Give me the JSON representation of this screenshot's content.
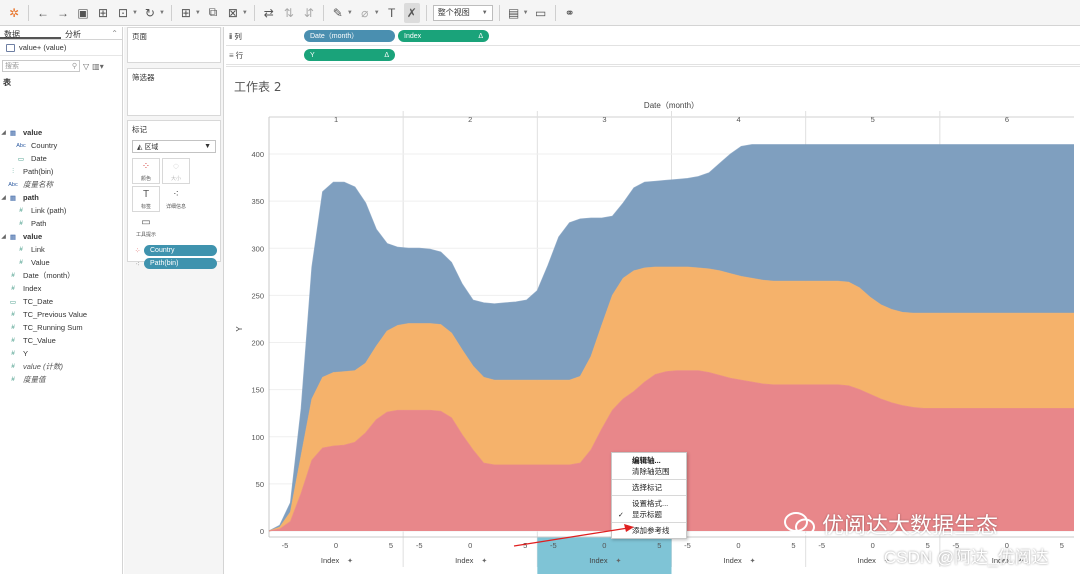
{
  "toolbar": {
    "fit_select": "整个视图"
  },
  "data_pane": {
    "tabs": [
      "数据",
      "分析"
    ],
    "datasource": "value+ (value)",
    "search_placeholder": "搜索",
    "section_title": "表",
    "fields": [
      {
        "label": "value",
        "kind": "table",
        "level": 0,
        "style": "bold",
        "caret": true
      },
      {
        "label": "Country",
        "kind": "abc",
        "level": 1
      },
      {
        "label": "Date",
        "kind": "date",
        "level": 1
      },
      {
        "label": "Path(bin)",
        "kind": "bin",
        "level": 0
      },
      {
        "label": "度量名称",
        "kind": "abc",
        "level": 0,
        "style": "italic"
      },
      {
        "label": "path",
        "kind": "table",
        "level": 0,
        "style": "bold",
        "caret": true
      },
      {
        "label": "Link (path)",
        "kind": "num",
        "level": 1
      },
      {
        "label": "Path",
        "kind": "num",
        "level": 1
      },
      {
        "label": "value",
        "kind": "table",
        "level": 0,
        "style": "bold",
        "caret": true
      },
      {
        "label": "Link",
        "kind": "num",
        "level": 1
      },
      {
        "label": "Value",
        "kind": "num",
        "level": 1
      },
      {
        "label": "Date（month）",
        "kind": "num",
        "level": 0
      },
      {
        "label": "Index",
        "kind": "num",
        "level": 0
      },
      {
        "label": "TC_Date",
        "kind": "date",
        "level": 0
      },
      {
        "label": "TC_Previous Value",
        "kind": "num",
        "level": 0
      },
      {
        "label": "TC_Running Sum",
        "kind": "num",
        "level": 0
      },
      {
        "label": "TC_Value",
        "kind": "num",
        "level": 0
      },
      {
        "label": "Y",
        "kind": "num",
        "level": 0
      },
      {
        "label": "value (计数)",
        "kind": "num",
        "level": 0,
        "style": "italic"
      },
      {
        "label": "度量值",
        "kind": "num",
        "level": 0,
        "style": "italic"
      }
    ]
  },
  "cards": {
    "pages": "页面",
    "filters": "筛选器",
    "marks": "标记",
    "mark_type": "区域",
    "mark_buttons": [
      "颜色",
      "大小",
      "标签",
      "详细信息",
      "工具提示"
    ],
    "mark_pills": [
      "Country",
      "Path(bin)"
    ]
  },
  "shelves": {
    "columns_label": "列",
    "rows_label": "行",
    "column_pills": [
      "Date（month）",
      "Index"
    ],
    "row_pills": [
      "Y"
    ],
    "delta": "Δ"
  },
  "sheet": {
    "title": "工作表 2"
  },
  "chart_data": {
    "type": "area",
    "top_title": "Date（month）",
    "panels": [
      "1",
      "2",
      "3",
      "4",
      "5",
      "6"
    ],
    "ylabel": "Y",
    "ylim": [
      0,
      420
    ],
    "yticks": [
      0,
      50,
      100,
      150,
      200,
      250,
      300,
      350,
      400
    ],
    "xlabel": "Index",
    "xticks": [
      "-5",
      "0",
      "5"
    ],
    "x": [
      -5,
      -4,
      -3,
      -2,
      -1,
      0,
      1,
      2,
      3,
      4,
      5,
      6,
      7,
      8,
      9,
      10,
      11,
      12,
      13,
      14,
      15,
      16,
      17,
      18,
      19,
      20,
      21,
      22,
      23,
      24,
      25,
      26,
      27,
      28,
      29,
      30,
      31,
      32,
      33,
      34,
      35,
      36,
      37,
      38,
      39,
      40,
      41,
      42,
      43,
      44,
      45,
      46,
      47,
      48,
      49,
      50,
      51,
      52,
      53,
      54,
      55,
      56,
      57,
      58,
      59,
      60,
      61,
      62,
      63,
      64,
      65,
      66,
      67,
      68,
      69,
      70
    ],
    "colors": [
      "#e8878a",
      "#f5b26b",
      "#7f9fbf"
    ],
    "layer_boundaries": [
      [
        0,
        2,
        10,
        40,
        75,
        88,
        90,
        91,
        94,
        104,
        118,
        126,
        128,
        128,
        128,
        128,
        127,
        120,
        102,
        86,
        72,
        70,
        70,
        70,
        70,
        70,
        70,
        70,
        70,
        72,
        86,
        108,
        128,
        140,
        148,
        158,
        166,
        169,
        170,
        170,
        170,
        168,
        165,
        162,
        160,
        158,
        156,
        155,
        155,
        155,
        155,
        155,
        155,
        155,
        154,
        150,
        145,
        140,
        136,
        133,
        131,
        130,
        130,
        130,
        130,
        130,
        130,
        130,
        130,
        130,
        130,
        130,
        130,
        130,
        130,
        130
      ],
      [
        0,
        4,
        20,
        80,
        140,
        163,
        168,
        169,
        170,
        178,
        196,
        212,
        218,
        220,
        220,
        220,
        219,
        210,
        192,
        175,
        163,
        160,
        160,
        160,
        160,
        160,
        160,
        160,
        160,
        164,
        185,
        218,
        250,
        268,
        276,
        279,
        280,
        280,
        280,
        280,
        279,
        278,
        276,
        273,
        270,
        268,
        266,
        265,
        265,
        265,
        265,
        265,
        265,
        265,
        264,
        258,
        248,
        240,
        235,
        232,
        231,
        231,
        231,
        231,
        231,
        231,
        231,
        231,
        231,
        231,
        231,
        231,
        231,
        231,
        231,
        231
      ],
      [
        0,
        6,
        30,
        130,
        280,
        360,
        370,
        370,
        365,
        348,
        320,
        305,
        301,
        300,
        300,
        299,
        296,
        285,
        262,
        245,
        242,
        241,
        242,
        243,
        245,
        255,
        282,
        312,
        327,
        331,
        332,
        332,
        334,
        348,
        364,
        370,
        371,
        372,
        373,
        374,
        376,
        380,
        390,
        400,
        408,
        410,
        410,
        410,
        410,
        410,
        410,
        410,
        410,
        410,
        410,
        410,
        410,
        410,
        410,
        410,
        410,
        410,
        410,
        410,
        410,
        410,
        410,
        410,
        410,
        410,
        410,
        410,
        410,
        410,
        410,
        410
      ]
    ]
  },
  "context_menu": {
    "items": [
      "编辑轴...",
      "清除轴范围",
      "选择标记",
      "设置格式...",
      "显示标题",
      "添加参考线"
    ]
  },
  "watermark": {
    "line1": "优阅达大数据生态",
    "line2": "CSDN @阿达_优阅达"
  }
}
